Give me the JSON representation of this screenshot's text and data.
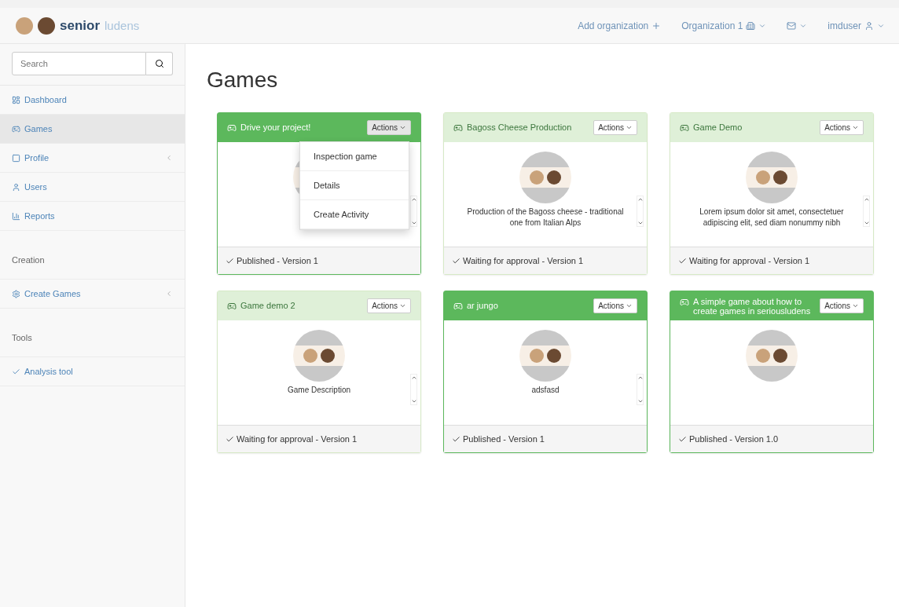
{
  "brand": {
    "name": "senior",
    "suffix": "ludens"
  },
  "navbar": {
    "items": [
      {
        "kind": "add",
        "label": "Add organization"
      },
      {
        "kind": "org",
        "label": "Organization 1"
      },
      {
        "kind": "mail"
      },
      {
        "kind": "user",
        "label": "imduser"
      }
    ]
  },
  "search": {
    "placeholder": "Search"
  },
  "sidebar": {
    "items": [
      {
        "kind": "link",
        "label": "Dashboard",
        "selected": false
      },
      {
        "kind": "link",
        "label": "Games",
        "selected": true
      },
      {
        "kind": "link",
        "label": "Profile",
        "selected": false,
        "expanded": false
      },
      {
        "kind": "link",
        "label": "Users",
        "selected": false
      },
      {
        "kind": "link",
        "label": "Reports",
        "selected": false
      },
      {
        "kind": "heading",
        "label": "Creation"
      },
      {
        "kind": "link",
        "label": "Create Games",
        "selected": false,
        "expanded": false
      },
      {
        "kind": "heading",
        "label": "Tools"
      },
      {
        "kind": "link",
        "label": "Analysis tool",
        "selected": false
      }
    ]
  },
  "page_title": "Games",
  "games": [
    {
      "title": "Drive your project!",
      "published": true,
      "actions": "Actions",
      "menu_open": true,
      "menu": [
        "Inspection game",
        "Details",
        "Create Activity"
      ],
      "scrollable": true,
      "status": "Published - Version 1"
    },
    {
      "title": "Bagoss Cheese Production",
      "published": false,
      "actions": "Actions",
      "menu_open": false,
      "description": "Production of the Bagoss cheese - traditional one from Italian Alps",
      "scrollable": true,
      "status": "Waiting for approval - Version 1"
    },
    {
      "title": "Game Demo",
      "published": false,
      "actions": "Actions",
      "menu_open": false,
      "description": "Lorem ipsum dolor sit amet, consectetuer adipiscing elit, sed diam nonummy nibh",
      "scrollable": true,
      "status": "Waiting for approval - Version 1"
    },
    {
      "title": "Game demo 2",
      "published": false,
      "actions": "Actions",
      "menu_open": false,
      "description": "Game Description",
      "scrollable": true,
      "status": "Waiting for approval - Version 1"
    },
    {
      "title": "ar jungo",
      "published": true,
      "actions": "Actions",
      "menu_open": false,
      "description": "adsfasd",
      "scrollable": true,
      "status": "Published - Version 1"
    },
    {
      "title": "A simple game about how to create games in seriousludens",
      "published": true,
      "actions": "Actions",
      "menu_open": false,
      "scrollable": false,
      "status": "Published - Version 1.0"
    }
  ]
}
